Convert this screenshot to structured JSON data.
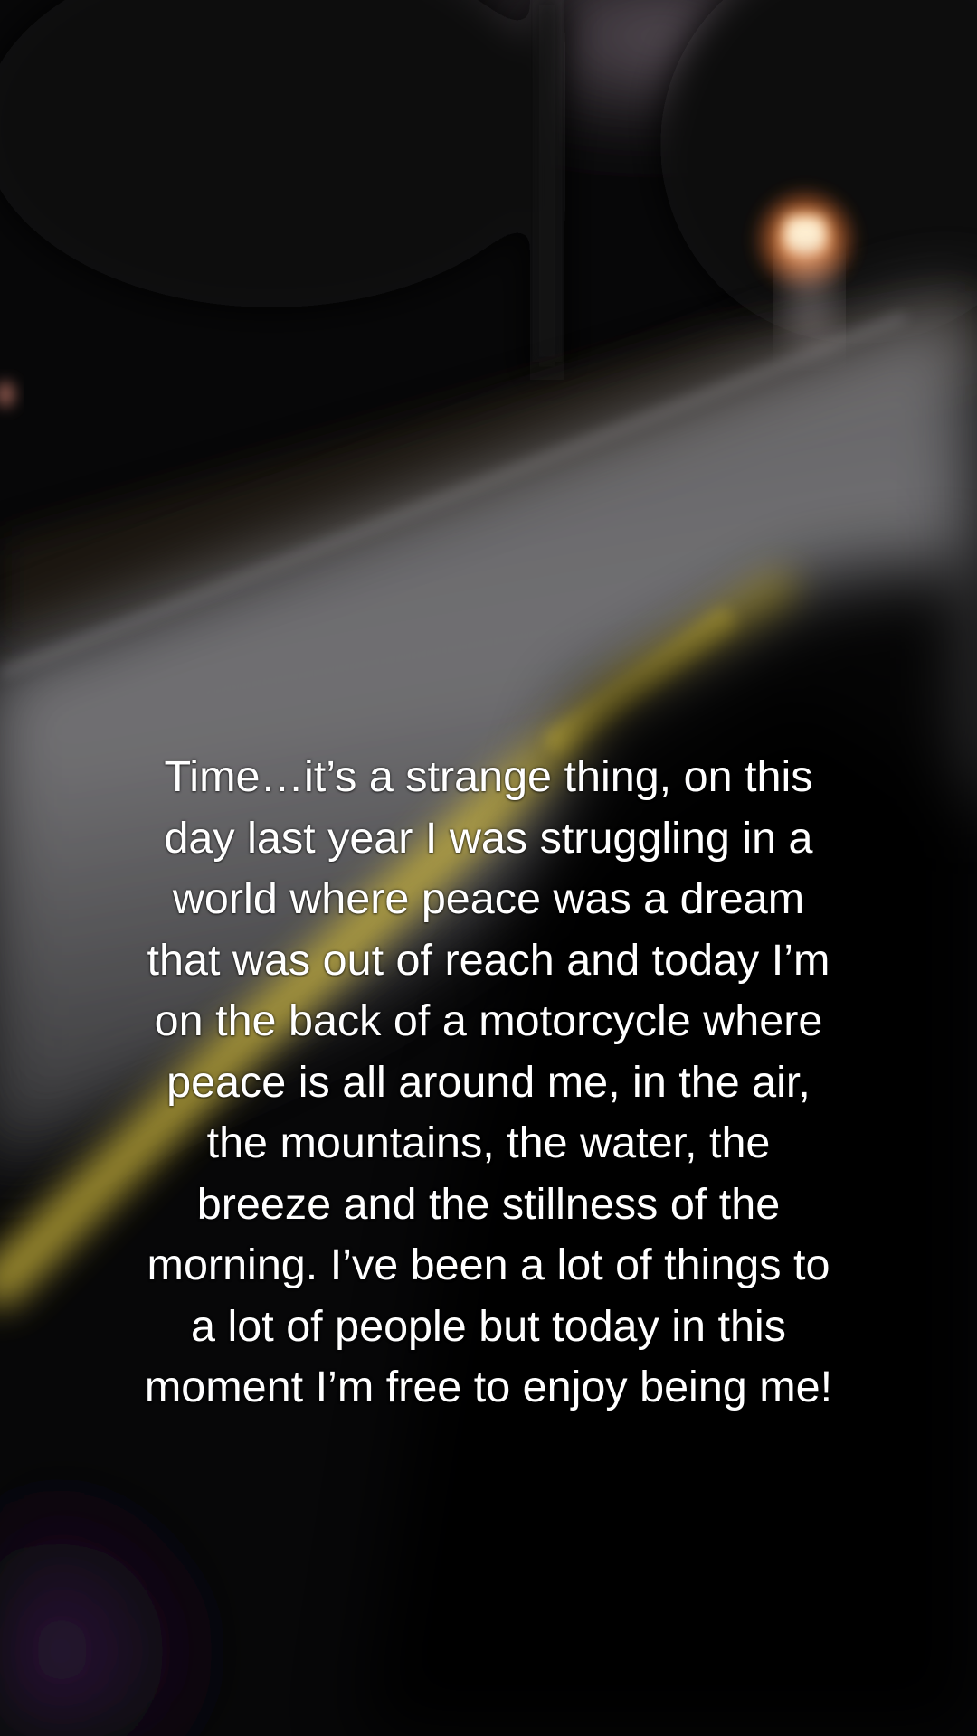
{
  "caption": {
    "lines": [
      "Time…it’s a strange thing, on this",
      "day last year I was struggling in a",
      "world where peace was a dream",
      "that was out of reach and today I’m",
      "on the back of a motorcycle where",
      "peace is all around me, in the air,",
      "the mountains, the water, the",
      "breeze and the stillness of the",
      "morning.  I’ve been a lot of things to",
      "a lot of people but today in this",
      "moment I’m free to enjoy being me!"
    ]
  },
  "scene": {
    "description_colors": {
      "sky": "#6f6270",
      "road": "#7d7c7e",
      "road_line": "#c9b73a",
      "street_light": "#ffd2a0",
      "purple_glow": "#3a1a4a"
    }
  }
}
